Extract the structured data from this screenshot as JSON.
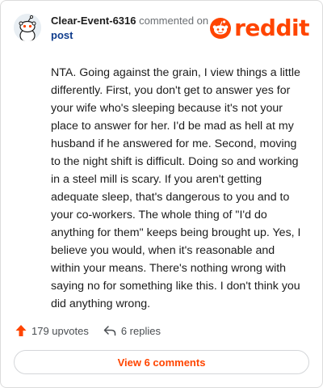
{
  "comment": {
    "username": "Clear-Event-6316",
    "action_text": "commented on",
    "post_link": "post",
    "body": "NTA. Going against the grain, I view things a little differently. First, you don't get to answer yes for your wife who's sleeping because it's not your place to answer for her. I'd be mad as hell at my husband if he answered for me. Second, moving to the night shift is difficult. Doing so and working in a steel mill is scary. If you aren't getting adequate sleep, that's dangerous to you and to your co-workers. The whole thing of \"I'd do anything for them\" keeps being brought up. Yes, I believe you would, when it's reasonable and within your means. There's nothing wrong with saying no for something like this. I don't think you did anything wrong."
  },
  "brand": {
    "wordmark": "reddit",
    "color": "#ff4500",
    "icon": "reddit-snoo-icon"
  },
  "stats": {
    "upvotes": "179 upvotes",
    "replies": "6 replies"
  },
  "footer": {
    "view_comments": "View 6 comments"
  }
}
